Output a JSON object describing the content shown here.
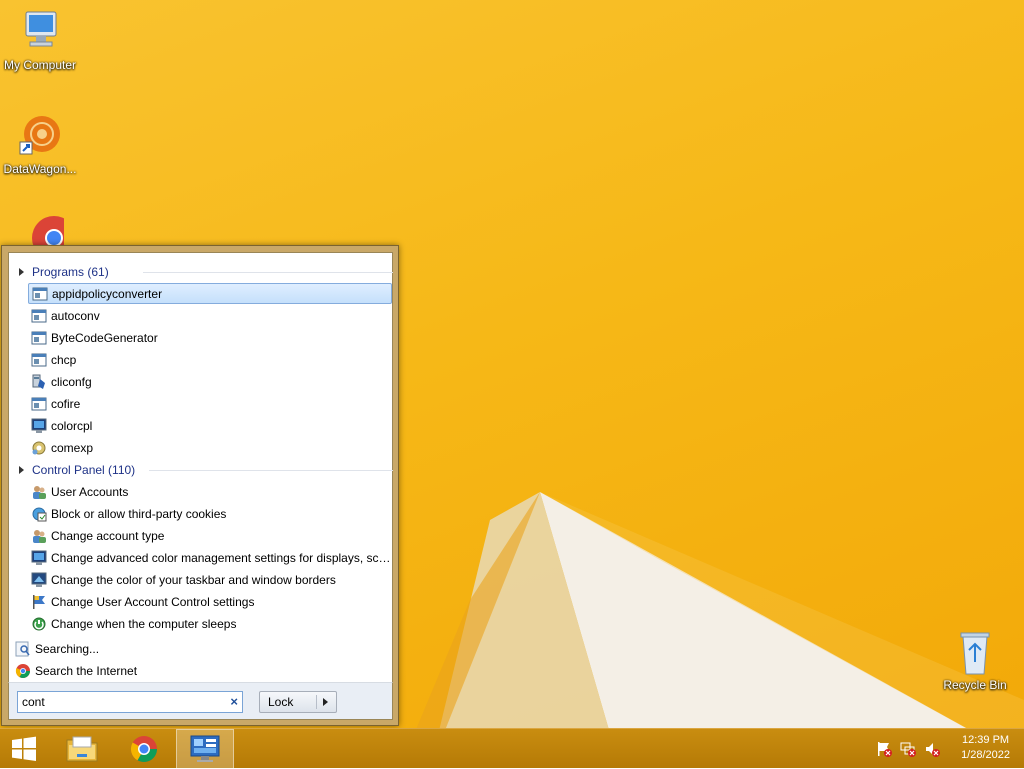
{
  "desktop": {
    "icons": [
      {
        "label": "My Computer",
        "icon": "computer-icon"
      },
      {
        "label": "DataWagon...",
        "icon": "datawagon-icon"
      },
      {
        "label": "",
        "icon": "chrome-icon"
      },
      {
        "label": "Recycle Bin",
        "icon": "recycle-bin-icon"
      }
    ]
  },
  "start_menu": {
    "programs_header": "Programs (61)",
    "programs": [
      {
        "label": "appidpolicyconverter",
        "icon": "console-app-icon",
        "selected": true
      },
      {
        "label": "autoconv",
        "icon": "console-app-icon"
      },
      {
        "label": "ByteCodeGenerator",
        "icon": "console-app-icon"
      },
      {
        "label": "chcp",
        "icon": "console-app-icon"
      },
      {
        "label": "cliconfg",
        "icon": "sql-config-icon"
      },
      {
        "label": "cofire",
        "icon": "console-app-icon"
      },
      {
        "label": "colorcpl",
        "icon": "display-icon"
      },
      {
        "label": "comexp",
        "icon": "component-services-icon"
      }
    ],
    "control_panel_header": "Control Panel (110)",
    "control_panel": [
      {
        "label": "User Accounts",
        "icon": "users-icon"
      },
      {
        "label": "Block or allow third-party cookies",
        "icon": "internet-options-icon"
      },
      {
        "label": "Change account type",
        "icon": "users-icon"
      },
      {
        "label": "Change advanced color management settings for displays, sca...",
        "icon": "display-icon"
      },
      {
        "label": "Change the color of your taskbar and window borders",
        "icon": "personalize-icon"
      },
      {
        "label": "Change User Account Control settings",
        "icon": "uac-flag-icon"
      },
      {
        "label": "Change when the computer sleeps",
        "icon": "power-icon"
      }
    ],
    "searching": "Searching...",
    "search_internet": "Search the Internet",
    "search_value": "cont",
    "lock_label": "Lock",
    "clear_symbol": "×"
  },
  "taskbar": {
    "buttons": [
      "start-button",
      "file-explorer",
      "chrome",
      "classic-shell"
    ],
    "time": "12:39 PM",
    "date": "1/28/2022"
  },
  "colors": {
    "desktop_accent": "#f6b817",
    "taskbar": "#b57a06",
    "link_blue": "#1e3287",
    "selection": "#c5e0fb"
  }
}
